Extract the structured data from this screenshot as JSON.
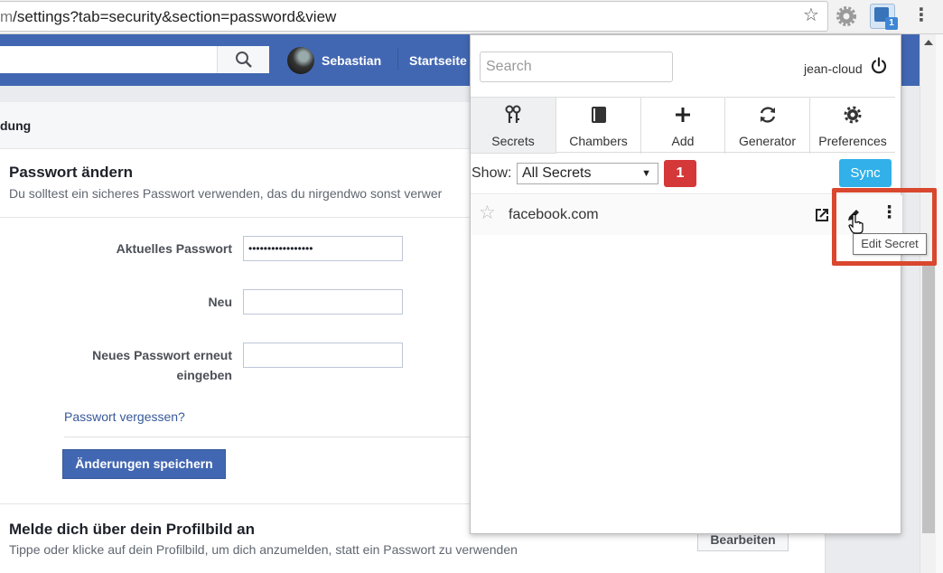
{
  "browser": {
    "url_prefix": "m",
    "url_rest": "/settings?tab=security&section=password&view",
    "bookmark_icon": "star-outline-icon",
    "ext_badge": "1"
  },
  "facebook": {
    "user_name": "Sebastian",
    "home_label": "Startseite",
    "section_header": "dung",
    "password": {
      "title": "Passwort ändern",
      "subtitle": "Du solltest ein sicheres Passwort verwenden, das du nirgendwo sonst verwer",
      "fields": [
        {
          "label": "Aktuelles Passwort",
          "value": "•••••••••••••••••"
        },
        {
          "label": "Neu",
          "value": ""
        },
        {
          "label_line1": "Neues Passwort erneut",
          "label_line2": "eingeben",
          "value": ""
        }
      ],
      "forgot_link": "Passwort vergessen?",
      "save_button": "Änderungen speichern"
    },
    "profile_login": {
      "title": "Melde dich über dein Profilbild an",
      "subtitle": "Tippe oder klicke auf dein Profilbild, um dich anzumelden, statt ein Passwort zu verwenden",
      "edit_button": "Bearbeiten"
    }
  },
  "popup": {
    "search_placeholder": "Search",
    "user": "jean-cloud",
    "tabs": [
      {
        "label": "Secrets",
        "icon": "keys-icon",
        "active": true
      },
      {
        "label": "Chambers",
        "icon": "book-icon",
        "active": false
      },
      {
        "label": "Add",
        "icon": "plus-icon",
        "active": false
      },
      {
        "label": "Generator",
        "icon": "refresh-icon",
        "active": false
      },
      {
        "label": "Preferences",
        "icon": "gear-icon",
        "active": false
      }
    ],
    "filter": {
      "show_label": "Show:",
      "selected": "All Secrets",
      "count": "1",
      "sync_button": "Sync"
    },
    "secrets": [
      {
        "name": "facebook.com",
        "favorite": false
      }
    ],
    "tooltip": "Edit Secret"
  },
  "colors": {
    "facebook_blue": "#4267b2",
    "sync_blue": "#31b0e9",
    "count_red": "#d43838",
    "highlight": "#d9472e"
  }
}
